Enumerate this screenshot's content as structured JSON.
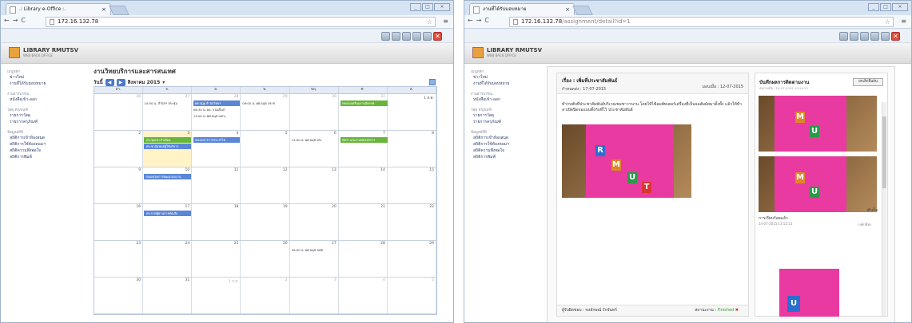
{
  "win1": {
    "tab_title": ".: Library e-Office :.",
    "url": "172.16.132.78",
    "url_path": "",
    "brand": "LIBRARY RMUTSV",
    "brand_sub": "WEB BACK OFFICE",
    "menu": [
      {
        "cat": "เมนูหลัก",
        "items": [
          "ข่าวใหม่",
          "งานที่ได้รับมอบหมาย"
        ]
      },
      {
        "cat": "งานสารบรรณ",
        "items": [
          "หนังสือเข้า-ออก"
        ]
      },
      {
        "cat": "วัสดุ ครุภัณฑ์",
        "items": [
          "รายการวัสดุ",
          "รายการครุภัณฑ์"
        ]
      },
      {
        "cat": "ข้อมูลสถิติ",
        "items": [
          "สถิติการเข้าห้องสมุด",
          "สถิติการใช้ห้องคอมฯ",
          "สถิติความพึงพอใจ",
          "สถิติการพิมพ์"
        ]
      }
    ],
    "calendar": {
      "title": "งานวิทยบริการและสารสนเทศ",
      "today_btn": "วันนี้",
      "month": "สิงหาคม 2015",
      "days": [
        "อา.",
        "จ.",
        "อ.",
        "พ.",
        "พฤ.",
        "ศ.",
        "ส."
      ],
      "weeks": [
        [
          "26",
          "27",
          "28",
          "29",
          "30",
          "31",
          "1 ส.ค."
        ],
        [
          "2",
          "3",
          "4",
          "5",
          "6",
          "7",
          "8"
        ],
        [
          "9",
          "10",
          "11",
          "12",
          "13",
          "14",
          "15"
        ],
        [
          "16",
          "17",
          "18",
          "19",
          "20",
          "21",
          "22"
        ],
        [
          "23",
          "24",
          "25",
          "26",
          "27",
          "28",
          "29"
        ],
        [
          "30",
          "31",
          "1 ก.ย.",
          "2",
          "3",
          "4",
          "5"
        ]
      ],
      "events": {
        "e1": "10:00 น. สำนักฯ ประชุม",
        "e2": "ผศ.ลฎฐ สำนักวิทยฯ",
        "e3": "09:00 น. ผศ.อนุช ประช",
        "e4": "ทดลองเตรียมงานนิทรรศ",
        "e5": "08:30 น. ผอ. รวมเป็นกั",
        "e6": "13:00 น. ผศ.อนุช แลกเ",
        "e7": "ประชุมประจำเดือน",
        "e8": "ประชาสัมพันธ์ผู้ใช้บริการ",
        "e9": "ส่งเอกสารการประจำไต",
        "e10": "13:00 น. ผศ.อนุช ประ",
        "e11": "มีทรานามงานนิทรรศการ",
        "e12": "ส่งผลสอบการพัฒนาผลงาน",
        "e13": "ประกาศผู้ผ่านการคัดเลือ",
        "e14": "09:00 น. ผศ.อนุช ขอมิ"
      }
    }
  },
  "win2": {
    "tab_title": "งานที่ได้รับมอบหมาย",
    "url": "172.16.132.78",
    "url_path": "/assignment/detail?id=1",
    "brand": "LIBRARY RMUTSV",
    "brand_sub": "WEB BACK OFFICE",
    "menu": [
      {
        "cat": "เมนูหลัก",
        "items": [
          "ข่าวใหม่",
          "งานที่ได้รับมอบหมาย"
        ]
      },
      {
        "cat": "งานสารบรรณ",
        "items": [
          "หนังสือเข้า-ออก"
        ]
      },
      {
        "cat": "วัสดุ ครุภัณฑ์",
        "items": [
          "รายการวัสดุ",
          "รายการครุภัณฑ์"
        ]
      },
      {
        "cat": "ข้อมูลสถิติ",
        "items": [
          "สถิติการเข้าห้องสมุด",
          "สถิติการใช้ห้องคอมฯ",
          "สถิติความพึงพอใจ",
          "สถิติการพิมพ์"
        ]
      }
    ],
    "task": {
      "title": "เรื่อง : เพิ่มที่ประชาสัมพันธ์",
      "due": "กำหนดส่ง : 17-07-2015",
      "assigned": "มอบเมื่อ : 12-07-2015",
      "body": "ทำกบพับที่ประชาสัมพันธ์บริเวณชมชาวานาน โดยให้ไฟ้อมพ์ทเตอร์เครื่องที่เป็นจอสัมผัสมาตั้งทั้ง แล้วให้ทั่วลาเปิดปิดจอแบบตั้งกับที่ใว้ ประชาสัมพันธ์",
      "responsible": "ผู้รับผิดชอบ : ขงลักษณ์ รักจันทร์",
      "status_label": "สถานะงาน : ",
      "status_value": "Finished",
      "status_x": "✖"
    },
    "progress": {
      "title": "บันทึกผลการติดตามงาน",
      "ts": "ส่งงานเมื่อ : 14-07-2015 15:14:13",
      "cancel_btn": "ยกเลิกยืนยัน",
      "note1": "สำเร็จ",
      "note2": "การเรียบร้อยแล้ว",
      "ts2": "14-07-2015 13:52:31",
      "who": "รงศักดิ์พร"
    }
  }
}
